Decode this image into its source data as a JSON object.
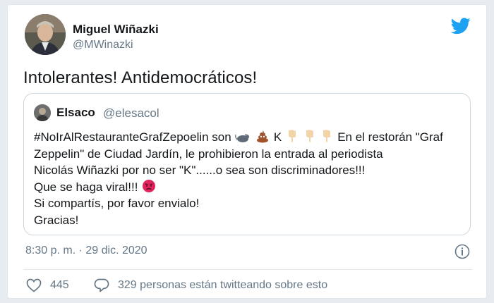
{
  "tweet": {
    "author_name": "Miguel Wiñazki",
    "author_handle": "@MWinazki",
    "text": "Intolerantes! Antidemocráticos!",
    "timestamp": "8:30 p. m. · 29 dic. 2020",
    "likes": "445",
    "discussion": "329 personas están twitteando sobre esto"
  },
  "quoted": {
    "author_name": "Elsaco",
    "author_handle": "@elesacol",
    "line1_a": "#NoIrAlRestauranteGrafZepoelin son",
    "line1_b": "K",
    "line1_c": "En el restorán \"Graf",
    "line2": "Zeppelin\" de Ciudad Jardín,  le prohibieron la entrada al periodista",
    "line3": "Nicolás Wiñazki por no ser \"K\"......o sea son discriminadores!!!",
    "line4": "Que se haga viral!!!",
    "line5": "Si compartís,  por favor envialo!",
    "line6": "Gracias!"
  },
  "icons": {
    "brand": "twitter-bird-icon",
    "like": "heart-icon",
    "reply": "speech-bubble-icon",
    "info": "info-icon",
    "emojis": [
      "rat-emoji",
      "poop-emoji",
      "point-down-emoji",
      "point-down-emoji",
      "point-down-emoji",
      "angry-face-emoji"
    ]
  },
  "colors": {
    "twitter_blue": "#1da1f2",
    "secondary_text": "#657786",
    "border": "#ccd6dd"
  }
}
